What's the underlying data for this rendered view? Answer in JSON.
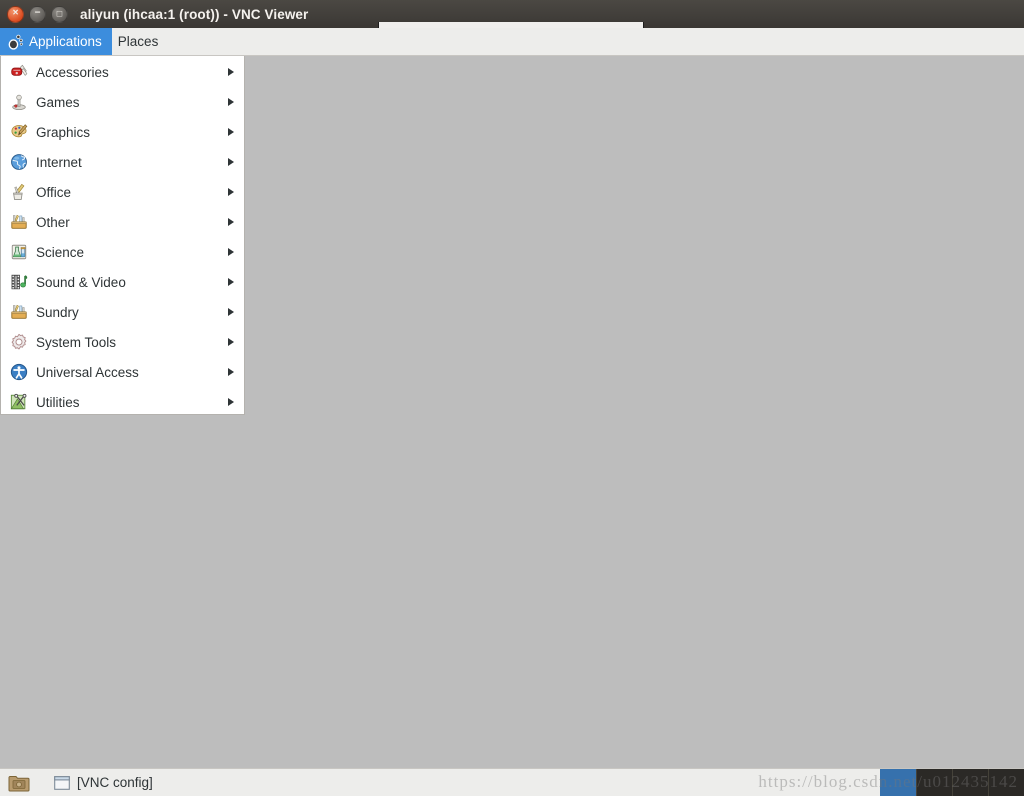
{
  "window": {
    "title": "aliyun (ihcaa:1 (root)) - VNC Viewer",
    "controls": {
      "close_label": "×",
      "minimize_label": "−",
      "maximize_label": "□"
    }
  },
  "top_panel": {
    "applications_label": "Applications",
    "places_label": "Places"
  },
  "applications_menu": {
    "items": [
      {
        "label": "Accessories",
        "icon": "swiss-army-knife-icon",
        "has_submenu": true
      },
      {
        "label": "Games",
        "icon": "joystick-icon",
        "has_submenu": true
      },
      {
        "label": "Graphics",
        "icon": "paint-palette-icon",
        "has_submenu": true
      },
      {
        "label": "Internet",
        "icon": "globe-icon",
        "has_submenu": true
      },
      {
        "label": "Office",
        "icon": "pen-cup-icon",
        "has_submenu": true
      },
      {
        "label": "Other",
        "icon": "toolbox-icon",
        "has_submenu": true
      },
      {
        "label": "Science",
        "icon": "flask-icon",
        "has_submenu": true
      },
      {
        "label": "Sound & Video",
        "icon": "filmstrip-note-icon",
        "has_submenu": true
      },
      {
        "label": "Sundry",
        "icon": "toolbox-icon",
        "has_submenu": true
      },
      {
        "label": "System Tools",
        "icon": "gear-icon",
        "has_submenu": true
      },
      {
        "label": "Universal Access",
        "icon": "accessibility-icon",
        "has_submenu": true
      },
      {
        "label": "Utilities",
        "icon": "scissors-map-icon",
        "has_submenu": true
      }
    ]
  },
  "taskbar": {
    "show_desktop_icon": "folder-icon",
    "tasks": [
      {
        "label": "[VNC config]",
        "icon": "window-icon"
      }
    ],
    "workspaces": [
      {
        "active": true
      },
      {
        "active": false
      },
      {
        "active": false
      },
      {
        "active": false
      }
    ]
  },
  "watermark": {
    "text": "https://blog.csdn.net/u012435142"
  },
  "colors": {
    "desktop": "#bdbdbd",
    "panel": "#ededeb",
    "titlebar": "#413e3a",
    "accent": "#3c8ddd",
    "close_button": "#db4c20",
    "workspace_active": "#3671ad"
  }
}
